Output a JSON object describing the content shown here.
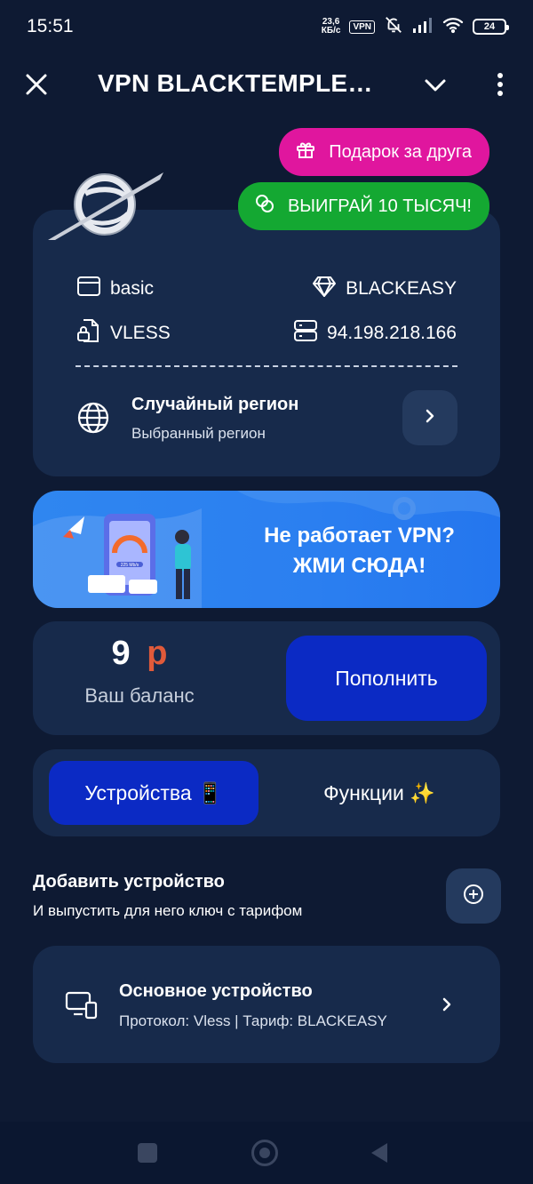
{
  "status_bar": {
    "time": "15:51",
    "speed_value": "23,6",
    "speed_unit": "КБ/с",
    "vpn_badge": "VPN",
    "battery": "24"
  },
  "header": {
    "title": "VPN BLACKTEMPLE…"
  },
  "promos": {
    "gift_label": "Подарок за друга",
    "win_label": "ВЫИГРАЙ 10 ТЫСЯЧ!"
  },
  "subscription": {
    "plan": "basic",
    "tariff": "BLACKEASY",
    "protocol": "VLESS",
    "server_ip": "94.198.218.166",
    "region_title": "Случайный регион",
    "region_subtitle": "Выбранный регион"
  },
  "banner": {
    "line1": "Не работает VPN?",
    "line2": "ЖМИ СЮДА!",
    "speed_readout": "225 Mb/s"
  },
  "balance": {
    "amount": "9",
    "currency": "р",
    "label": "Ваш баланс",
    "topup_label": "Пополнить"
  },
  "tabs": {
    "devices": "Устройства 📱",
    "features": "Функции ✨"
  },
  "add_device": {
    "title": "Добавить устройство",
    "subtitle": "И выпустить для него ключ с тарифом"
  },
  "devices": [
    {
      "name": "Основное устройство",
      "details": "Протокол: Vless | Тариф: BLACKEASY"
    }
  ],
  "colors": {
    "background": "#0e1a33",
    "card": "#172a4b",
    "primary_button": "#0b2ac4",
    "gift_pill": "#e0169e",
    "win_pill": "#14a832",
    "currency": "#e05a3a",
    "banner": "#2f86f0"
  },
  "icons": {
    "close": "close-icon",
    "dropdown": "chevron-down-icon",
    "menu": "more-vertical-icon",
    "gift": "gift-icon",
    "coins": "coins-icon",
    "plan": "browser-window-icon",
    "tariff": "diamond-icon",
    "protocol": "lock-file-icon",
    "server": "server-icon",
    "region": "globe-icon",
    "add": "plus-circle-icon",
    "device": "devices-icon"
  }
}
